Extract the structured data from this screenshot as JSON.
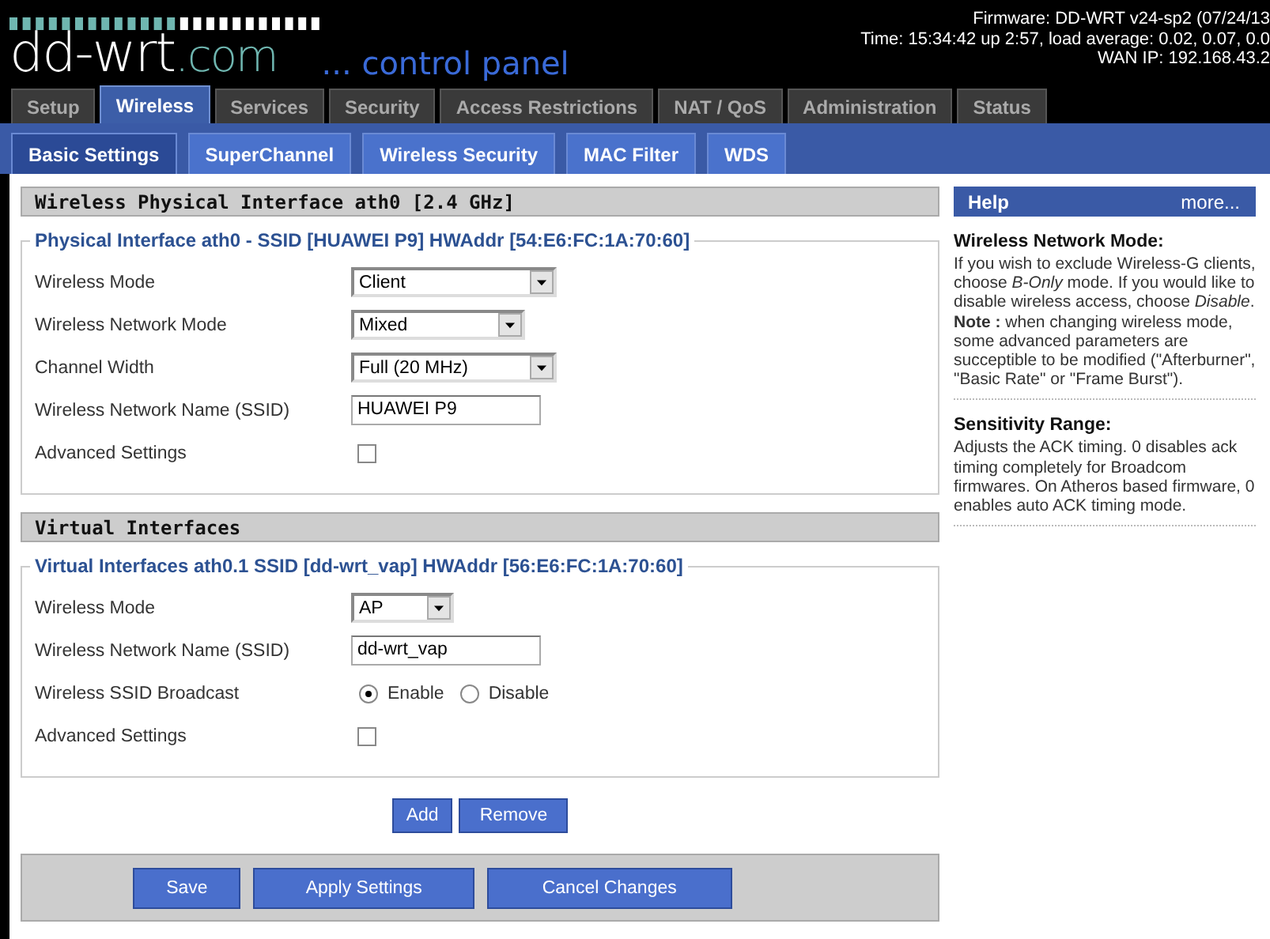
{
  "header": {
    "logo": "dd-wrt",
    "logo_suffix": ".com",
    "tagline": "... control panel",
    "info": [
      "Firmware: DD-WRT v24-sp2 (07/24/13",
      "Time: 15:34:42 up 2:57, load average: 0.02, 0.07, 0.0",
      "WAN IP: 192.168.43.2"
    ]
  },
  "tabs": [
    {
      "label": "Setup",
      "selected": false
    },
    {
      "label": "Wireless",
      "selected": true
    },
    {
      "label": "Services",
      "selected": false
    },
    {
      "label": "Security",
      "selected": false
    },
    {
      "label": "Access Restrictions",
      "selected": false
    },
    {
      "label": "NAT / QoS",
      "selected": false
    },
    {
      "label": "Administration",
      "selected": false
    },
    {
      "label": "Status",
      "selected": false
    }
  ],
  "subtabs": [
    {
      "label": "Basic Settings",
      "selected": true
    },
    {
      "label": "SuperChannel",
      "selected": false
    },
    {
      "label": "Wireless Security",
      "selected": false
    },
    {
      "label": "MAC Filter",
      "selected": false
    },
    {
      "label": "WDS",
      "selected": false
    }
  ],
  "sections": [
    {
      "title": "Wireless Physical Interface ath0 [2.4 GHz]",
      "legend": "Physical Interface ath0 - SSID [HUAWEI P9] HWAddr [54:E6:FC:1A:70:60]",
      "rows": [
        {
          "kind": "select",
          "label": "Wireless Mode",
          "value": "Client"
        },
        {
          "kind": "select",
          "label": "Wireless Network Mode",
          "value": "Mixed"
        },
        {
          "kind": "select",
          "label": "Channel Width",
          "value": "Full (20 MHz)"
        },
        {
          "kind": "text",
          "label": "Wireless Network Name (SSID)",
          "value": "HUAWEI P9"
        },
        {
          "kind": "checkbox",
          "label": "Advanced Settings",
          "checked": false
        }
      ]
    },
    {
      "title": "Virtual Interfaces",
      "legend": "Virtual Interfaces ath0.1 SSID [dd-wrt_vap] HWAddr [56:E6:FC:1A:70:60]",
      "rows": [
        {
          "kind": "select",
          "label": "Wireless Mode",
          "value": "AP"
        },
        {
          "kind": "text",
          "label": "Wireless Network Name (SSID)",
          "value": "dd-wrt_vap"
        },
        {
          "kind": "radio",
          "label": "Wireless SSID Broadcast",
          "options": [
            {
              "label": "Enable",
              "selected": true
            },
            {
              "label": "Disable",
              "selected": false
            }
          ]
        },
        {
          "kind": "checkbox",
          "label": "Advanced Settings",
          "checked": false
        }
      ]
    }
  ],
  "interface_buttons": [
    "Add",
    "Remove"
  ],
  "footer_buttons": [
    "Save",
    "Apply Settings",
    "Cancel Changes"
  ],
  "help": {
    "title": "Help",
    "more": "more...",
    "topics": [
      {
        "heading": "Wireless Network Mode:",
        "paragraphs": [
          "If you wish to exclude Wireless-G clients, choose *B-Only* mode. If you would like to disable wireless access, choose *Disable*.",
          "**Note :** when changing wireless mode, some advanced parameters are succeptible to be modified (\"Afterburner\", \"Basic Rate\" or \"Frame Burst\")."
        ]
      },
      {
        "heading": "Sensitivity Range:",
        "paragraphs": [
          "Adjusts the ACK timing. 0 disables ack timing completely for Broadcom firmwares. On Atheros based firmware, 0 enables auto ACK timing mode."
        ]
      }
    ]
  }
}
